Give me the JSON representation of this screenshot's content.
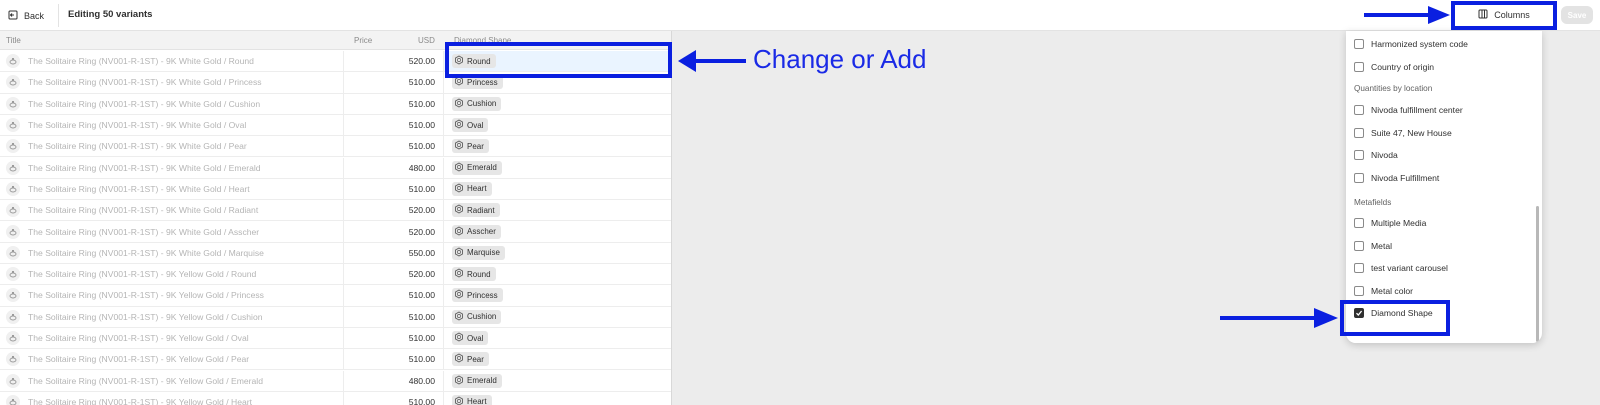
{
  "topbar": {
    "back_label": "Back",
    "title": "Editing 50 variants",
    "columns_label": "Columns",
    "save_label": "Save"
  },
  "grid": {
    "headers": {
      "title": "Title",
      "price": "Price",
      "currency": "USD",
      "shape": "Diamond Shape"
    },
    "rows": [
      {
        "title": "The Solitaire Ring (NV001-R-1ST) - 9K White Gold / Round",
        "price": "520.00",
        "shape": "Round"
      },
      {
        "title": "The Solitaire Ring (NV001-R-1ST) - 9K White Gold / Princess",
        "price": "510.00",
        "shape": "Princess"
      },
      {
        "title": "The Solitaire Ring (NV001-R-1ST) - 9K White Gold / Cushion",
        "price": "510.00",
        "shape": "Cushion"
      },
      {
        "title": "The Solitaire Ring (NV001-R-1ST) - 9K White Gold / Oval",
        "price": "510.00",
        "shape": "Oval"
      },
      {
        "title": "The Solitaire Ring (NV001-R-1ST) - 9K White Gold / Pear",
        "price": "510.00",
        "shape": "Pear"
      },
      {
        "title": "The Solitaire Ring (NV001-R-1ST) - 9K White Gold / Emerald",
        "price": "480.00",
        "shape": "Emerald"
      },
      {
        "title": "The Solitaire Ring (NV001-R-1ST) - 9K White Gold / Heart",
        "price": "510.00",
        "shape": "Heart"
      },
      {
        "title": "The Solitaire Ring (NV001-R-1ST) - 9K White Gold / Radiant",
        "price": "520.00",
        "shape": "Radiant"
      },
      {
        "title": "The Solitaire Ring (NV001-R-1ST) - 9K White Gold / Asscher",
        "price": "520.00",
        "shape": "Asscher"
      },
      {
        "title": "The Solitaire Ring (NV001-R-1ST) - 9K White Gold / Marquise",
        "price": "550.00",
        "shape": "Marquise"
      },
      {
        "title": "The Solitaire Ring (NV001-R-1ST) - 9K Yellow Gold / Round",
        "price": "520.00",
        "shape": "Round"
      },
      {
        "title": "The Solitaire Ring (NV001-R-1ST) - 9K Yellow Gold / Princess",
        "price": "510.00",
        "shape": "Princess"
      },
      {
        "title": "The Solitaire Ring (NV001-R-1ST) - 9K Yellow Gold / Cushion",
        "price": "510.00",
        "shape": "Cushion"
      },
      {
        "title": "The Solitaire Ring (NV001-R-1ST) - 9K Yellow Gold / Oval",
        "price": "510.00",
        "shape": "Oval"
      },
      {
        "title": "The Solitaire Ring (NV001-R-1ST) - 9K Yellow Gold / Pear",
        "price": "510.00",
        "shape": "Pear"
      },
      {
        "title": "The Solitaire Ring (NV001-R-1ST) - 9K Yellow Gold / Emerald",
        "price": "480.00",
        "shape": "Emerald"
      },
      {
        "title": "The Solitaire Ring (NV001-R-1ST) - 9K Yellow Gold / Heart",
        "price": "510.00",
        "shape": "Heart"
      }
    ]
  },
  "columns_panel": {
    "items_top": [
      {
        "label": "Harmonized system code",
        "checked": false
      },
      {
        "label": "Country of origin",
        "checked": false
      }
    ],
    "section_locations": "Quantities by location",
    "locations": [
      {
        "label": "Nivoda fulfillment center",
        "checked": false
      },
      {
        "label": "Suite 47, New House",
        "checked": false
      },
      {
        "label": "Nivoda",
        "checked": false
      },
      {
        "label": "Nivoda Fulfillment",
        "checked": false
      }
    ],
    "section_metafields": "Metafields",
    "metafields": [
      {
        "label": "Multiple Media",
        "checked": false
      },
      {
        "label": "Metal",
        "checked": false
      },
      {
        "label": "test variant carousel",
        "checked": false
      },
      {
        "label": "Metal color",
        "checked": false
      },
      {
        "label": "Diamond Shape",
        "checked": true
      }
    ]
  },
  "annotations": {
    "callout_text": "Change or Add",
    "color": "#0a1fe0"
  }
}
